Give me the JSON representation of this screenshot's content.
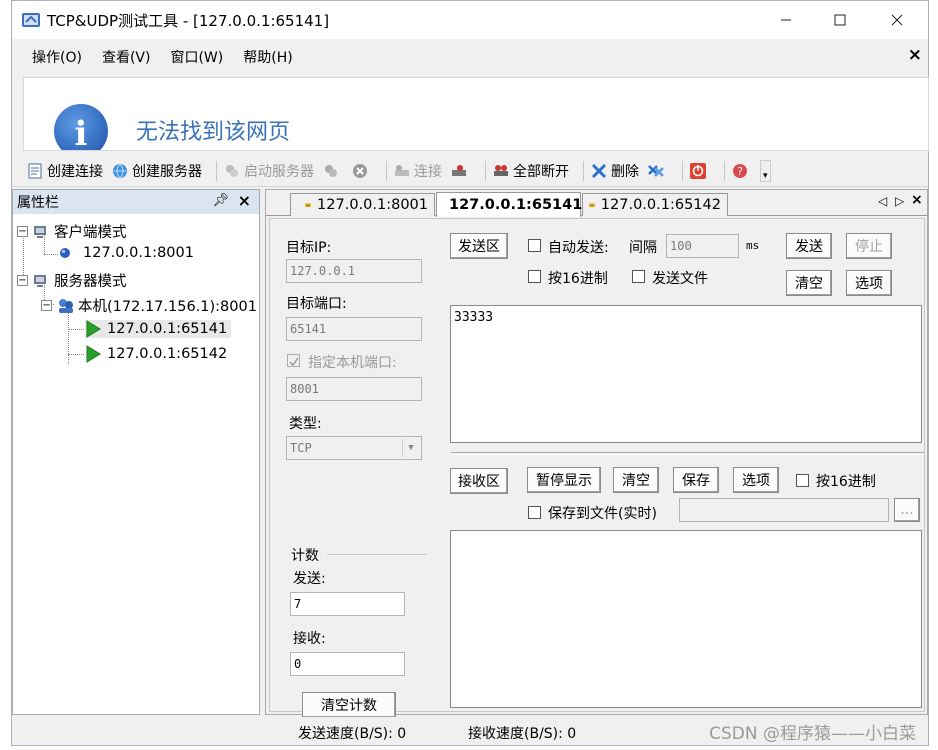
{
  "window": {
    "title": "TCP&UDP测试工具 - [127.0.0.1:65141]"
  },
  "menu": [
    "操作(O)",
    "查看(V)",
    "窗口(W)",
    "帮助(H)"
  ],
  "banner": {
    "message": "无法找到该网页"
  },
  "toolbar": {
    "create_connection": "创建连接",
    "create_server": "创建服务器",
    "start_server": "启动服务器",
    "connect": "连接",
    "disconnect_all": "全部断开",
    "delete": "删除"
  },
  "leftpane": {
    "title": "属性栏",
    "client_mode": "客户端模式",
    "client_conn": "127.0.0.1:8001",
    "server_mode": "服务器模式",
    "server_host": "本机(172.17.156.1):8001",
    "server_conns": [
      "127.0.0.1:65141",
      "127.0.0.1:65142"
    ]
  },
  "tabs": [
    "127.0.0.1:8001",
    "127.0.0.1:65141",
    "127.0.0.1:65142"
  ],
  "config": {
    "target_ip_label": "目标IP:",
    "target_ip": "127.0.0.1",
    "target_port_label": "目标端口:",
    "target_port": "65141",
    "local_port_label": "指定本机端口:",
    "local_port": "8001",
    "type_label": "类型:",
    "type_value": "TCP"
  },
  "counter": {
    "title": "计数",
    "send_label": "发送:",
    "send_value": "7",
    "recv_label": "接收:",
    "recv_value": "0",
    "clear_button": "清空计数"
  },
  "send": {
    "area_button": "发送区",
    "auto_send": "自动发送:",
    "interval_label": "间隔",
    "interval_value": "100",
    "unit": "ms",
    "send_button": "发送",
    "stop_button": "停止",
    "hex_label": "按16进制",
    "send_file_label": "发送文件",
    "clear_button": "清空",
    "options_button": "选项",
    "content": "33333"
  },
  "recv": {
    "area_button": "接收区",
    "pause_button": "暂停显示",
    "clear_button": "清空",
    "save_button": "保存",
    "options_button": "选项",
    "hex_label": "按16进制",
    "save_file_label": "保存到文件(实时)",
    "browse_button": "...",
    "content": ""
  },
  "status": {
    "send_speed": "发送速度(B/S): 0",
    "recv_speed": "接收速度(B/S): 0",
    "watermark": "CSDN @程序猿——小白菜"
  }
}
